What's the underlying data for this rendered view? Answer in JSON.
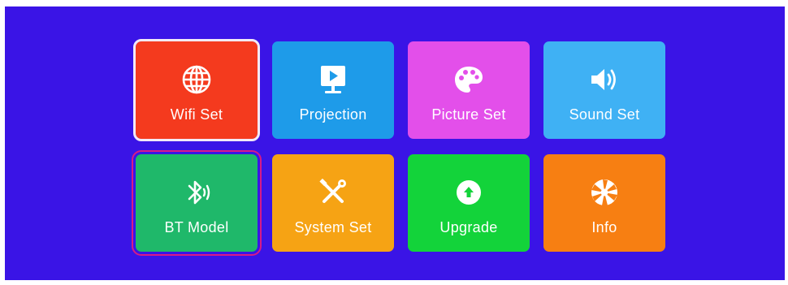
{
  "menu": {
    "tiles": [
      {
        "label": "Wifi Set",
        "icon": "wifi-globe-icon",
        "color": "#f43a1e"
      },
      {
        "label": "Projection",
        "icon": "projection-icon",
        "color": "#1e9be9"
      },
      {
        "label": "Picture Set",
        "icon": "palette-icon",
        "color": "#e34fea"
      },
      {
        "label": "Sound Set",
        "icon": "speaker-icon",
        "color": "#3fb1f4"
      },
      {
        "label": "BT Model",
        "icon": "bluetooth-icon",
        "color": "#1fb86a"
      },
      {
        "label": "System Set",
        "icon": "tools-icon",
        "color": "#f6a314"
      },
      {
        "label": "Upgrade",
        "icon": "upgrade-icon",
        "color": "#13d33a"
      },
      {
        "label": "Info",
        "icon": "aperture-icon",
        "color": "#f77f12"
      }
    ]
  },
  "colors": {
    "background": "#3a14e6",
    "focus_outline": "#f3e9f7",
    "secondary_outline": "#d81a86"
  }
}
